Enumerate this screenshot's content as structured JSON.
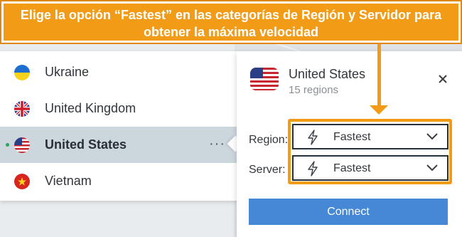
{
  "annotation": {
    "text": "Elige la opción “Fastest” en las categorías de Región y Servidor para obtener la máxima velocidad"
  },
  "countries": [
    {
      "name": "Ukraine",
      "flag": "ukraine-flag-icon",
      "active": false
    },
    {
      "name": "United Kingdom",
      "flag": "uk-flag-icon",
      "active": false
    },
    {
      "name": "United States",
      "flag": "us-flag-icon",
      "active": true
    },
    {
      "name": "Vietnam",
      "flag": "vietnam-flag-icon",
      "active": false
    }
  ],
  "more_label": "···",
  "popup": {
    "title": "United States",
    "subtitle": "15 regions",
    "region_label": "Region:",
    "region_value": "Fastest",
    "server_label": "Server:",
    "server_value": "Fastest",
    "connect_label": "Connect"
  },
  "colors": {
    "accent": "#f29b17",
    "connect": "#4687d6",
    "active_row": "#ccd6dd",
    "online": "#31a35d"
  }
}
